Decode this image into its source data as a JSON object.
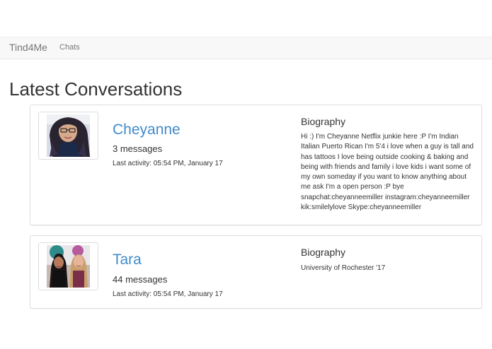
{
  "navbar": {
    "brand": "Tind4Me",
    "links": [
      {
        "label": "Chats"
      }
    ]
  },
  "page": {
    "title": "Latest Conversations"
  },
  "conversations": [
    {
      "name": "Cheyanne",
      "messages": "3 messages",
      "last_activity": "Last activity: 05:54 PM, January 17",
      "bio_heading": "Biography",
      "bio": "Hi :) I'm Cheyanne Netflix junkie here :P I'm Indian Italian Puerto Rican I'm 5'4 i love when a guy is tall and has tattoos I love being outside cooking & baking and being with friends and family i love kids i want some of my own someday if you want to know anything about me ask I'm a open person :P bye snapchat:cheyanneemiller instagram:cheyanneemiller kik:smilelylove Skype:cheyanneemiller",
      "avatar_icon": "profile-photo"
    },
    {
      "name": "Tara",
      "messages": "44 messages",
      "last_activity": "Last activity: 05:54 PM, January 17",
      "bio_heading": "Biography",
      "bio": "University of Rochester '17",
      "avatar_icon": "profile-photo"
    }
  ],
  "colors": {
    "link": "#428bca",
    "navbar_bg": "#f8f8f8",
    "navbar_text": "#777777",
    "border": "#dddddd"
  }
}
